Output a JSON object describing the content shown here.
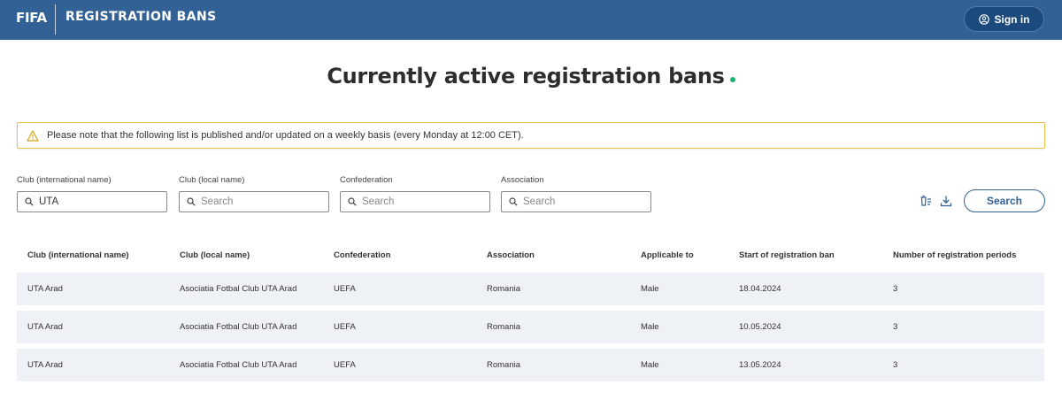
{
  "header": {
    "logo": "FIFA",
    "app_title": "REGISTRATION BANS",
    "signin_label": "Sign in"
  },
  "page": {
    "title": "Currently active registration bans"
  },
  "notice": {
    "text": "Please note that the following list is published and/or updated on a weekly basis (every Monday at 12:00 CET)."
  },
  "filters": [
    {
      "label": "Club (international name)",
      "value": "UTA",
      "placeholder": "Search"
    },
    {
      "label": "Club (local name)",
      "value": "",
      "placeholder": "Search"
    },
    {
      "label": "Confederation",
      "value": "",
      "placeholder": "Search"
    },
    {
      "label": "Association",
      "value": "",
      "placeholder": "Search"
    }
  ],
  "toolbar": {
    "clear_icon": "clear-filter-icon",
    "download_icon": "download-icon",
    "search_label": "Search"
  },
  "table": {
    "columns": [
      "Club (international name)",
      "Club (local name)",
      "Confederation",
      "Association",
      "Applicable to",
      "Start of registration ban",
      "Number of registration periods"
    ],
    "rows": [
      [
        "UTA Arad",
        "Asociatia Fotbal Club UTA Arad",
        "UEFA",
        "Romania",
        "Male",
        "18.04.2024",
        "3"
      ],
      [
        "UTA Arad",
        "Asociatia Fotbal Club UTA Arad",
        "UEFA",
        "Romania",
        "Male",
        "10.05.2024",
        "3"
      ],
      [
        "UTA Arad",
        "Asociatia Fotbal Club UTA Arad",
        "UEFA",
        "Romania",
        "Male",
        "13.05.2024",
        "3"
      ]
    ]
  },
  "colors": {
    "header_bg": "#326295",
    "accent": "#326295",
    "title_dot": "#16b36a",
    "notice_border": "#e6c34a",
    "row_bg": "#eef1f6"
  }
}
